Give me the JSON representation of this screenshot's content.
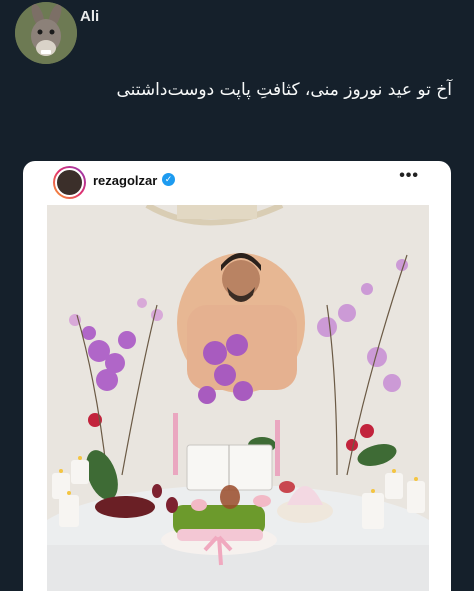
{
  "tweet": {
    "author_name": "Ali",
    "text": "آخ تو عید نوروز منی، کثافتِ پاپت دوست‌داشتنی"
  },
  "embedded_post": {
    "username": "rezagolzar",
    "verified_icon": "check-icon",
    "more_icon": "more-icon",
    "more_symbol": "•••"
  },
  "colors": {
    "background": "#15202b",
    "verified": "#1d9bf0",
    "orchid": "#b066c8",
    "wheatgrass": "#6c9a2c"
  }
}
